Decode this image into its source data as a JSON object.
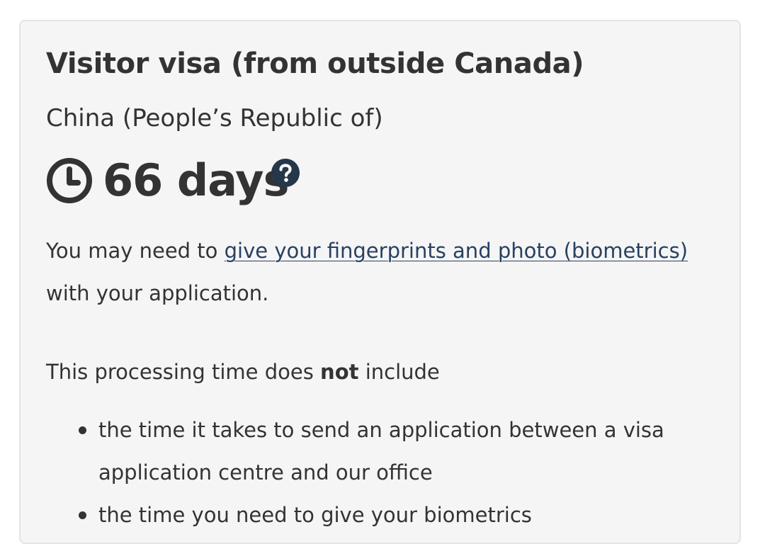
{
  "card": {
    "title": "Visitor visa (from outside Canada)",
    "country": "China (People’s Republic of)",
    "processing_time": "66 days",
    "icons": {
      "clock": "clock-icon",
      "help": "question-circle-icon"
    },
    "biometrics_note": {
      "before_link": "You may need to ",
      "link_text": "give your fingerprints and photo (biometrics)",
      "after_link": " with your application."
    },
    "exclusions_intro": {
      "before_bold": "This processing time does ",
      "bold": "not",
      "after_bold": " include"
    },
    "exclusions": [
      "the time it takes to send an application between a visa application centre and our office",
      "the time you need to give your biometrics"
    ]
  },
  "colors": {
    "text": "#333333",
    "link": "#284162",
    "help_icon_bg": "#26374a",
    "card_bg": "#f5f5f5",
    "card_border": "#e4e4e4"
  }
}
